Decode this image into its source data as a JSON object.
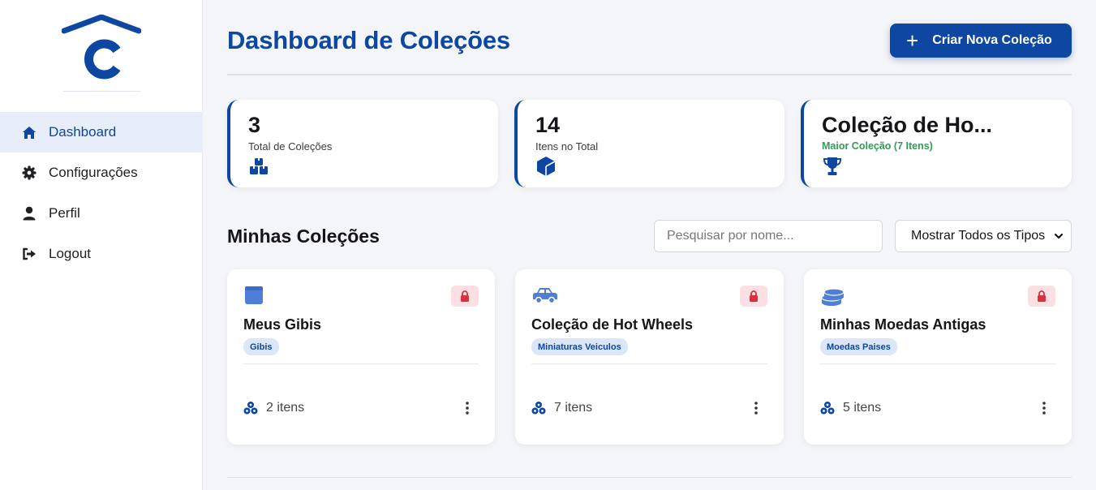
{
  "colors": {
    "primary": "#0d47a1",
    "success": "#2e9e57",
    "danger": "#d9303e",
    "background": "#f4f5f8"
  },
  "sidebar": {
    "logo_icon": "house-c-logo",
    "items": [
      {
        "label": "Dashboard",
        "icon": "home-icon",
        "active": true
      },
      {
        "label": "Configurações",
        "icon": "gear-icon",
        "active": false
      },
      {
        "label": "Perfil",
        "icon": "user-icon",
        "active": false
      },
      {
        "label": "Logout",
        "icon": "logout-icon",
        "active": false
      }
    ]
  },
  "header": {
    "title": "Dashboard de Coleções",
    "create_button": {
      "icon": "plus-icon",
      "label": "Criar Nova Coleção"
    }
  },
  "stats": [
    {
      "value": "3",
      "label": "Total de Coleções",
      "icon": "boxes-icon"
    },
    {
      "value": "14",
      "label": "Itens no Total",
      "icon": "cube-icon"
    },
    {
      "value": "Coleção de Ho...",
      "label": "Maior Coleção (7 Itens)",
      "icon": "trophy-icon"
    }
  ],
  "collections_section": {
    "title": "Minhas Coleções",
    "search": {
      "placeholder": "Pesquisar por nome...",
      "value": ""
    },
    "filter": {
      "selected": "Mostrar Todos os Tipos"
    }
  },
  "collections": [
    {
      "name": "Meus Gibis",
      "type": "Gibis",
      "items": "2 itens",
      "icon": "book-icon",
      "lock_icon": "lock-icon"
    },
    {
      "name": "Coleção de Hot Wheels",
      "type": "Miniaturas Veiculos",
      "items": "7 itens",
      "icon": "car-icon",
      "lock_icon": "lock-icon"
    },
    {
      "name": "Minhas Moedas Antigas",
      "type": "Moedas Paises",
      "items": "5 itens",
      "icon": "coins-icon",
      "lock_icon": "lock-icon"
    }
  ]
}
